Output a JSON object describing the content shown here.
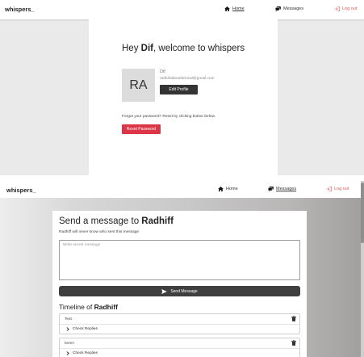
{
  "app": {
    "brand": "whispers_"
  },
  "nav": {
    "home": "Home",
    "messages": "Messages",
    "logout": "Log out"
  },
  "home_page": {
    "welcome_prefix": "Hey ",
    "user_name": "Dif",
    "welcome_suffix": ", welcome to whispers",
    "avatar_initials": "RA",
    "profile_name": "Dif",
    "profile_email": "radhifadiearfahrizal@gmail.com",
    "edit_profile": "Edit Profile",
    "forgot_text": "Forgot your password? Reset by clicking button below.",
    "reset_password": "Reset Password"
  },
  "messages_page": {
    "title_prefix": "Send a message to ",
    "recipient": "Radhiff",
    "subtitle": "Radhiff will never know who sent this message",
    "message_placeholder": "Write secret message",
    "send_button": "Send Message",
    "timeline_prefix": "Timeline of ",
    "timeline_name": "Radhiff",
    "timeline": [
      {
        "message": "Test",
        "replies_label": "Check Replies"
      },
      {
        "message": "keren",
        "replies_label": "Check Replies"
      }
    ]
  },
  "colors": {
    "danger": "#dc3545",
    "dark": "#343434",
    "logout": "#e25a5a"
  }
}
